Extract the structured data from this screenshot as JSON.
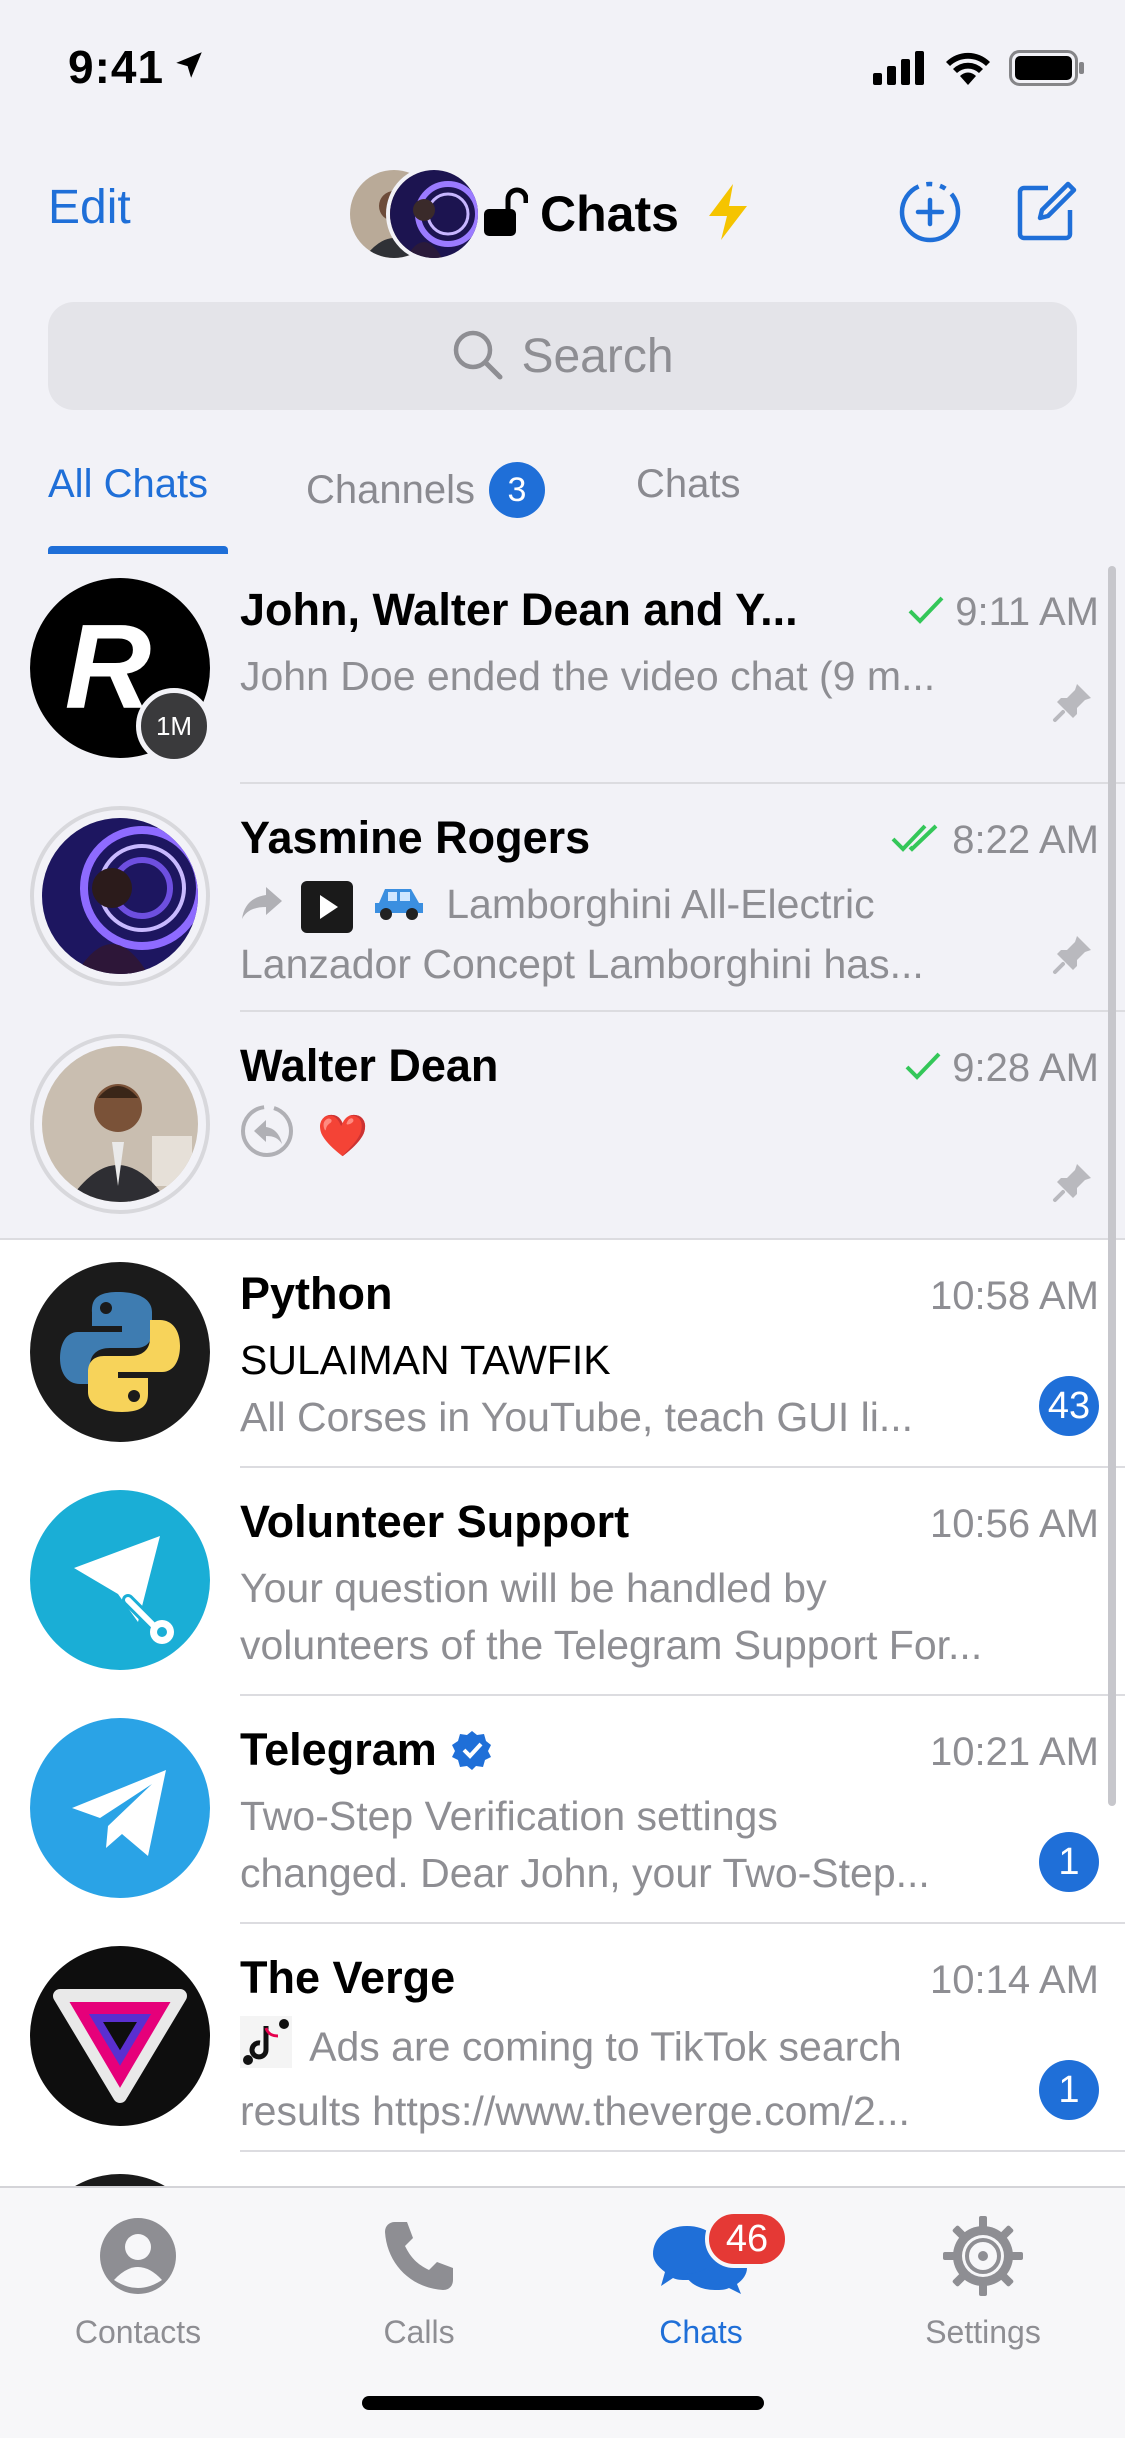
{
  "status_bar": {
    "time": "9:41"
  },
  "nav": {
    "edit_label": "Edit",
    "title": "Chats"
  },
  "search": {
    "placeholder": "Search"
  },
  "tabs": [
    {
      "label": "All Chats",
      "active": true
    },
    {
      "label": "Channels",
      "badge": "3"
    },
    {
      "label": "Chats"
    }
  ],
  "chats": [
    {
      "name": "John, Walter Dean and Y...",
      "time": "9:11 AM",
      "read": "single-check",
      "preview_line1": "John Doe ended the video chat (9 m...",
      "preview_line2": "",
      "pinned": true,
      "avatar_badge": "1M",
      "avatar_icon": "letter-r-logo"
    },
    {
      "name": "Yasmine Rogers",
      "time": "8:22 AM",
      "read": "double-check",
      "preview_line1": "Lamborghini All-Electric",
      "preview_line2": "Lanzador Concept Lamborghini has...",
      "pinned": true,
      "preview_icons": [
        "forward-icon",
        "video-thumbnail-icon",
        "car-emoji"
      ]
    },
    {
      "name": "Walter Dean",
      "time": "9:28 AM",
      "read": "single-check",
      "preview_line1": "❤️",
      "preview_line2": "",
      "pinned": true,
      "preview_icons": [
        "reply-icon"
      ]
    },
    {
      "name": "Python",
      "time": "10:58 AM",
      "sender": "SULAIMAN TAWFIK",
      "preview_line1": "All Corses in YouTube, teach GUI li...",
      "unread": "43"
    },
    {
      "name": "Volunteer Support",
      "time": "10:56 AM",
      "preview_line1": "Your question will be handled by",
      "preview_line2": "volunteers of the Telegram Support For..."
    },
    {
      "name": "Telegram",
      "time": "10:21 AM",
      "verified": true,
      "preview_line1": "Two-Step Verification settings",
      "preview_line2": "changed. Dear John, your Two-Step...",
      "unread": "1"
    },
    {
      "name": "The Verge",
      "time": "10:14 AM",
      "preview_line1": "Ads are coming to TikTok search",
      "preview_line2": "results https://www.theverge.com/2...",
      "unread": "1",
      "preview_icons": [
        "tiktok-thumbnail-icon"
      ]
    }
  ],
  "tabbar": [
    {
      "label": "Contacts",
      "icon": "person-icon"
    },
    {
      "label": "Calls",
      "icon": "phone-icon"
    },
    {
      "label": "Chats",
      "icon": "chat-bubbles-icon",
      "badge": "46",
      "active": true
    },
    {
      "label": "Settings",
      "icon": "gear-icon"
    }
  ],
  "colors": {
    "accent": "#1f6fd8",
    "read_check": "#34c759",
    "badge_red": "#e53935",
    "pinned_bg": "#f2f2f7"
  }
}
